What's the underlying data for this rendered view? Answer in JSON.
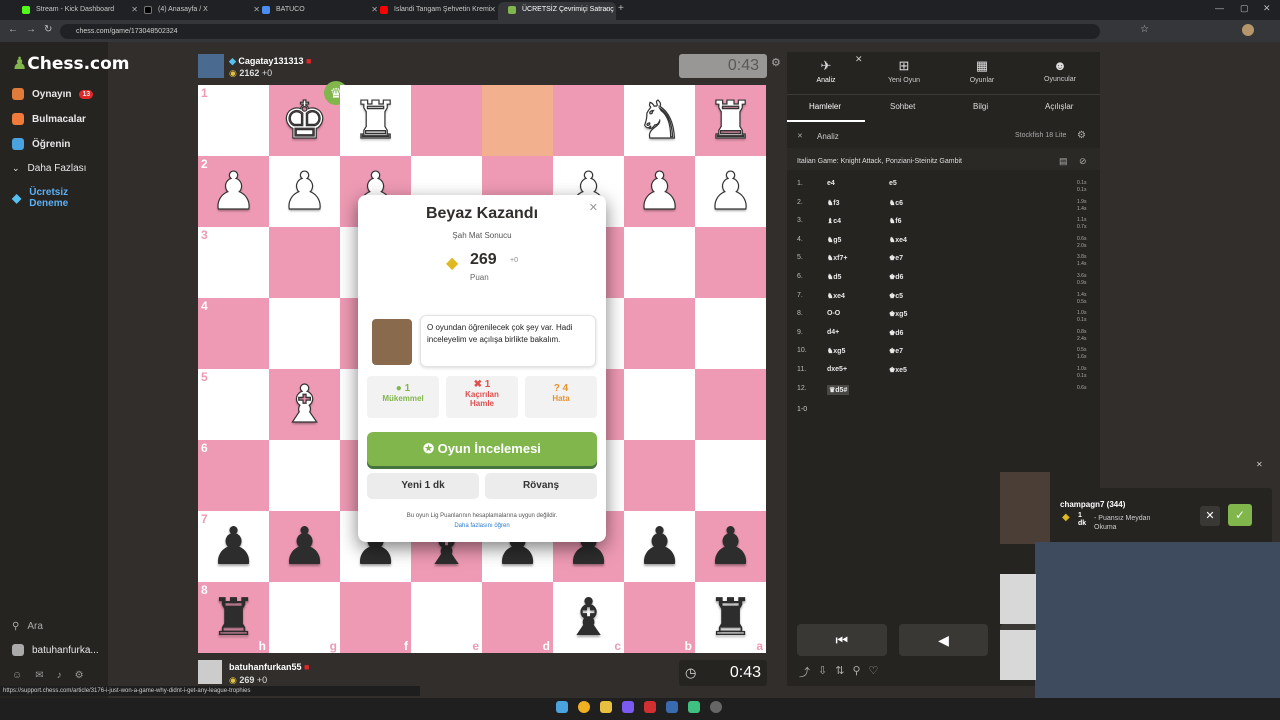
{
  "browser": {
    "tabs": [
      {
        "label": "Stream - Kick Dashboard",
        "color": "#53fc18"
      },
      {
        "label": "(4) Anasayfa / X",
        "color": "#000000"
      },
      {
        "label": "BATUCO",
        "color": "#4a8ef0"
      },
      {
        "label": "Islandi Tangam Şehvetin Kremi",
        "color": "#ff0000"
      },
      {
        "label": "ÜCRETSİZ Çevrimiçi Satranç",
        "color": "#81b64c"
      }
    ],
    "url": "chess.com/game/173048502324",
    "status_url": "https://support.chess.com/article/3176-i-just-won-a-game-why-didnt-i-get-any-league-trophies"
  },
  "sidebar": {
    "logo": "Chess.com",
    "items": [
      {
        "label": "Oynayın",
        "badge": "13"
      },
      {
        "label": "Bulmacalar"
      },
      {
        "label": "Öğrenin"
      },
      {
        "label": "Daha Fazlası"
      },
      {
        "label": "Ücretsiz Deneme"
      }
    ],
    "search": "Ara",
    "user": "batuhanfurka..."
  },
  "top_player": {
    "name": "Cagatay131313",
    "rating": "2162",
    "delta": "+0",
    "clock": "0:43"
  },
  "bottom_player": {
    "name": "batuhanfurkan55",
    "rating": "269",
    "delta": "+0",
    "clock": "0:43"
  },
  "board": {
    "ranks": [
      "1",
      "2",
      "3",
      "4",
      "5",
      "6",
      "7",
      "8"
    ],
    "files": [
      "h",
      "g",
      "f",
      "e",
      "d",
      "c",
      "b",
      "a"
    ]
  },
  "modal": {
    "title": "Beyaz Kazandı",
    "subtitle": "Şah Mat Sonucu",
    "points": "269",
    "points_delta": "+0",
    "points_label": "Puan",
    "coach_text": "O oyundan öğrenilecek çok şey var. Hadi inceleyelim ve açılışa birlikte bakalım.",
    "stats": [
      {
        "count": "1",
        "label": "Mükemmel",
        "color": "#81b64c"
      },
      {
        "count": "1",
        "label": "Kaçırılan Hamle",
        "color": "#e05050"
      },
      {
        "count": "4",
        "label": "Hata",
        "color": "#e8922b"
      }
    ],
    "review_button": "Oyun İncelemesi",
    "new_game_button": "Yeni 1 dk",
    "rematch_button": "Rövanş",
    "footer": "Bu oyun Lig Puanlarının hesaplamalarına uygun değildir.",
    "learn_more": "Daha fazlasını öğren"
  },
  "panel": {
    "top_tabs": [
      "Analiz",
      "Yeni Oyun",
      "Oyunlar",
      "Oyuncular"
    ],
    "sub_tabs": [
      "Hamleler",
      "Sohbet",
      "Bilgi",
      "Açılışlar"
    ],
    "analysis_label": "Analiz",
    "engine": "Stockfish 18 Lite",
    "opening": "Italian Game: Knight Attack, Ponziani-Steinitz Gambit",
    "moves": [
      {
        "no": "1.",
        "w": "e4",
        "b": "e5",
        "e1": "0.1s",
        "e2": "0.1s"
      },
      {
        "no": "2.",
        "w": "♞f3",
        "b": "♞c6",
        "e1": "1.9s",
        "e2": "1.4s"
      },
      {
        "no": "3.",
        "w": "♝c4",
        "b": "♞f6",
        "e1": "1.1s",
        "e2": "0.7s"
      },
      {
        "no": "4.",
        "w": "♞g5",
        "b": "♞xe4",
        "e1": "0.6s",
        "e2": "2.0s"
      },
      {
        "no": "5.",
        "w": "♞xf7+",
        "b": "♚e7",
        "e1": "3.8s",
        "e2": "1.4s"
      },
      {
        "no": "6.",
        "w": "♞d5",
        "b": "♚d6",
        "e1": "3.6s",
        "e2": "0.9s"
      },
      {
        "no": "7.",
        "w": "♞xe4",
        "b": "♚c5",
        "e1": "1.4s",
        "e2": "0.5s"
      },
      {
        "no": "8.",
        "w": "O-O",
        "b": "♚xg5",
        "e1": "1.0s",
        "e2": "0.1s"
      },
      {
        "no": "9.",
        "w": "d4+",
        "b": "♚d6",
        "e1": "0.8s",
        "e2": "2.4s"
      },
      {
        "no": "10.",
        "w": "♞xg5",
        "b": "♚e7",
        "e1": "0.5s",
        "e2": "1.6s"
      },
      {
        "no": "11.",
        "w": "dxe5+",
        "b": "♚xe5",
        "e1": "1.0s",
        "e2": "0.1s"
      },
      {
        "no": "12.",
        "w": "♛d5#",
        "b": "",
        "e1": "0.6s",
        "e2": ""
      }
    ],
    "result": "1-0"
  },
  "notification": {
    "name": "champagn7 (344)",
    "detail_time": "1 dk",
    "detail": "- Puansız Meydan Okuma"
  }
}
